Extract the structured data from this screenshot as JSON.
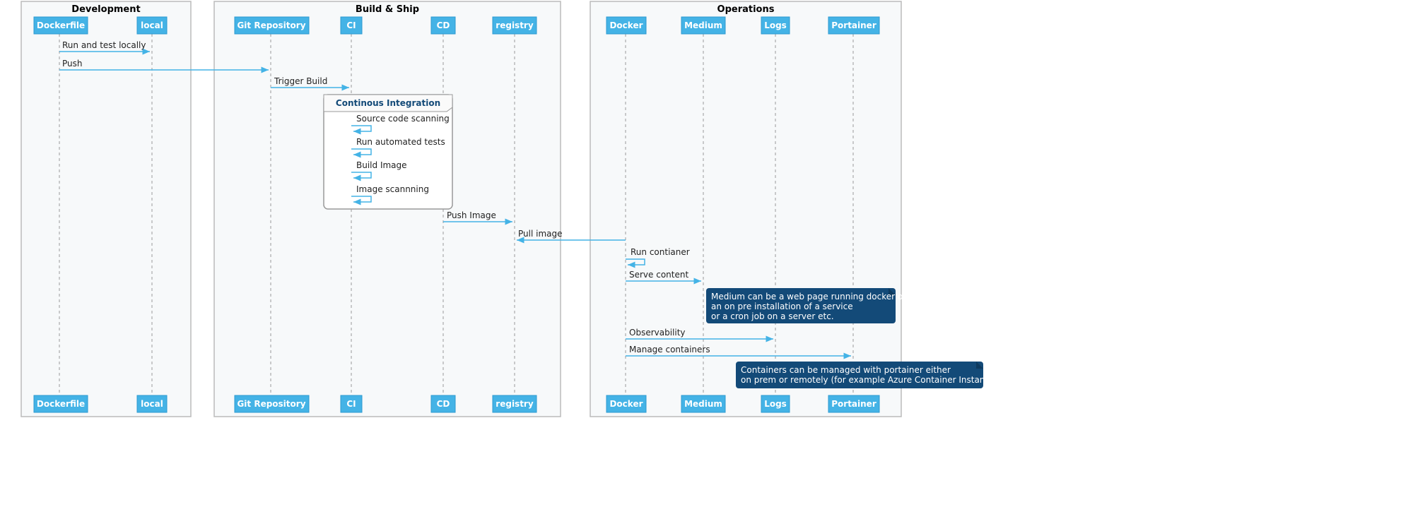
{
  "chart_data": {
    "type": "sequence-diagram",
    "groups": [
      {
        "id": "dev",
        "title": "Development",
        "participants": [
          "Dockerfile",
          "local"
        ]
      },
      {
        "id": "build",
        "title": "Build & Ship",
        "participants": [
          "Git Repository",
          "CI",
          "CD",
          "registry"
        ]
      },
      {
        "id": "ops",
        "title": "Operations",
        "participants": [
          "Docker",
          "Medium",
          "Logs",
          "Portainer"
        ]
      }
    ],
    "participants": [
      "Dockerfile",
      "local",
      "Git Repository",
      "CI",
      "CD",
      "registry",
      "Docker",
      "Medium",
      "Logs",
      "Portainer"
    ],
    "messages": [
      {
        "from": "Dockerfile",
        "to": "local",
        "label": "Run and test locally"
      },
      {
        "from": "Dockerfile",
        "to": "Git Repository",
        "label": "Push"
      },
      {
        "from": "Git Repository",
        "to": "CI",
        "label": "Trigger Build"
      },
      {
        "frame": "Continous Integration",
        "at": "CI",
        "steps": [
          "Source code scanning",
          "Run automated tests",
          "Build Image",
          "Image scannning"
        ]
      },
      {
        "from": "CD",
        "to": "registry",
        "label": "Push Image"
      },
      {
        "from": "Docker",
        "to": "registry",
        "label": "Pull image",
        "direction": "rtl"
      },
      {
        "from": "Docker",
        "to": "Docker",
        "label": "Run contianer",
        "self": true
      },
      {
        "from": "Docker",
        "to": "Medium",
        "label": "Serve content"
      },
      {
        "note_at": "Medium",
        "text": "Medium can be a web page running docker or\nan on pre installation of a service\nor a cron job on a server etc."
      },
      {
        "from": "Docker",
        "to": "Logs",
        "label": "Observability"
      },
      {
        "from": "Docker",
        "to": "Portainer",
        "label": "Manage containers"
      },
      {
        "note_at": "Portainer",
        "text": "Containers can be managed with portainer either\non prem or remotely (for example Azure Container Instances)"
      }
    ]
  },
  "groups": {
    "dev_title": "Development",
    "build_title": "Build & Ship",
    "ops_title": "Operations"
  },
  "participants": {
    "dockerfile": "Dockerfile",
    "local": "local",
    "git": "Git Repository",
    "ci": "CI",
    "cd": "CD",
    "registry": "registry",
    "docker": "Docker",
    "medium": "Medium",
    "logs": "Logs",
    "portainer": "Portainer"
  },
  "messages": {
    "run_local": "Run and test locally",
    "push": "Push",
    "trigger": "Trigger Build",
    "frame_title": "Continous Integration",
    "scan_src": "Source code scanning",
    "run_tests": "Run automated tests",
    "build_img": "Build Image",
    "scan_img": "Image scannning",
    "push_img": "Push Image",
    "pull_img": "Pull image",
    "run_ctr": "Run contianer",
    "serve": "Serve content",
    "obs": "Observability",
    "manage": "Manage containers"
  },
  "notes": {
    "medium_l1": "Medium can be a web page running docker or",
    "medium_l2": "an on pre installation of a service",
    "medium_l3": "or a cron job on a server etc.",
    "port_l1": "Containers can be managed with portainer either",
    "port_l2": "on prem or remotely (for example Azure Container Instances)"
  }
}
